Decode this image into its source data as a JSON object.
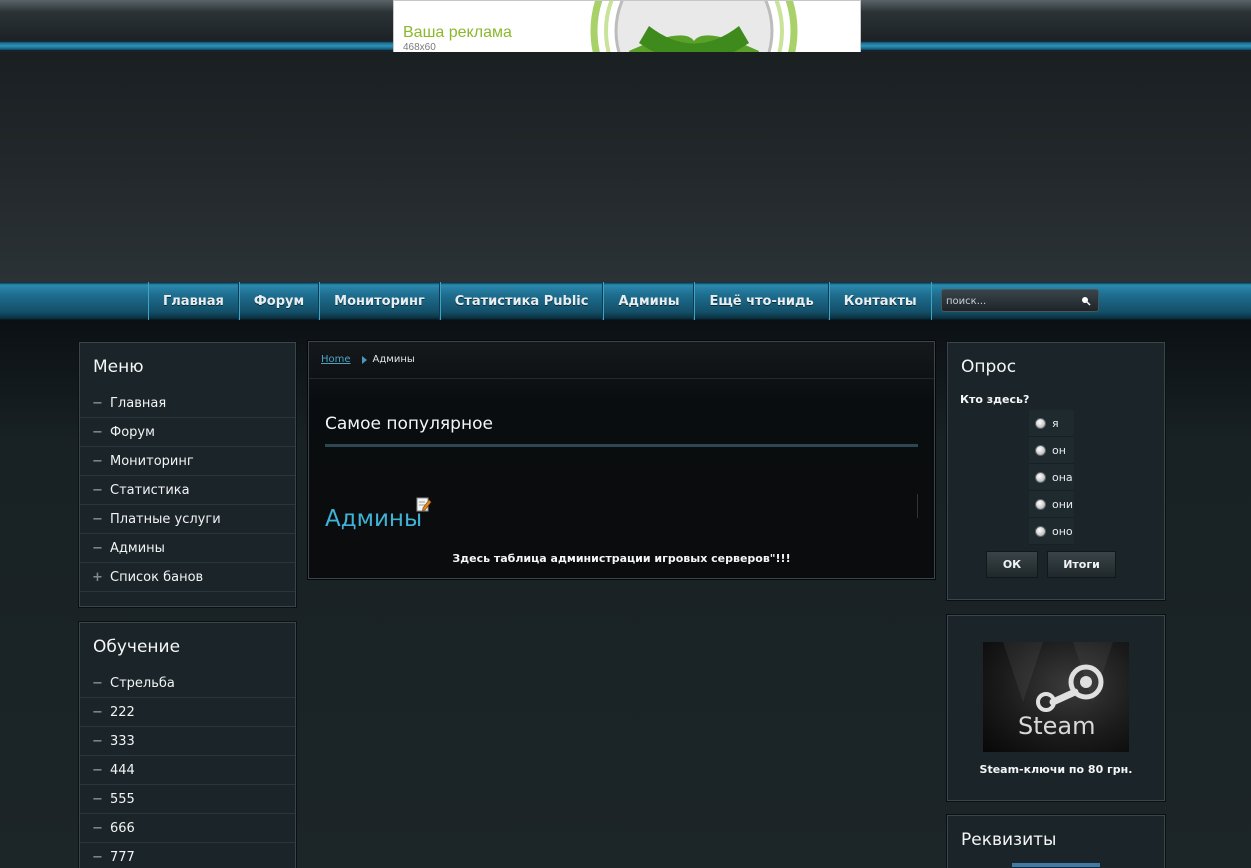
{
  "ad": {
    "title": "Ваша реклама",
    "size": "468x60"
  },
  "nav": [
    "Главная",
    "Форум",
    "Мониторинг",
    "Статистика Public",
    "Админы",
    "Ещё что-нидь",
    "Контакты"
  ],
  "search": {
    "placeholder": "поиск..."
  },
  "menu": {
    "title": "Меню",
    "items": [
      {
        "bullet": "−",
        "label": "Главная"
      },
      {
        "bullet": "−",
        "label": "Форум"
      },
      {
        "bullet": "−",
        "label": "Мониторинг"
      },
      {
        "bullet": "−",
        "label": "Статистика"
      },
      {
        "bullet": "−",
        "label": "Платные услуги"
      },
      {
        "bullet": "−",
        "label": "Админы"
      },
      {
        "bullet": "+",
        "label": "Список банов"
      }
    ]
  },
  "learning": {
    "title": "Обучение",
    "items": [
      {
        "bullet": "−",
        "label": "Стрельба"
      },
      {
        "bullet": "−",
        "label": "222"
      },
      {
        "bullet": "−",
        "label": "333"
      },
      {
        "bullet": "−",
        "label": "444"
      },
      {
        "bullet": "−",
        "label": "555"
      },
      {
        "bullet": "−",
        "label": "666"
      },
      {
        "bullet": "−",
        "label": "777"
      }
    ]
  },
  "breadcrumb": {
    "home": "Home",
    "current": "Админы"
  },
  "content": {
    "section_title": "Самое популярное",
    "article_title": "Админы",
    "article_text": "Здесь таблица администрации игровых серверов\"!!!"
  },
  "poll": {
    "title": "Опрос",
    "question": "Кто здесь?",
    "options": [
      "я",
      "он",
      "она",
      "они",
      "оно"
    ],
    "ok_label": "ОК",
    "results_label": "Итоги"
  },
  "steam": {
    "logo_text": "Steam",
    "caption": "Steam-ключи по 80 грн."
  },
  "requisites": {
    "title": "Реквизиты"
  },
  "colors": {
    "accent": "#3fb2d6",
    "nav_blue": "#1f6f91",
    "panel": "#1b2428"
  }
}
